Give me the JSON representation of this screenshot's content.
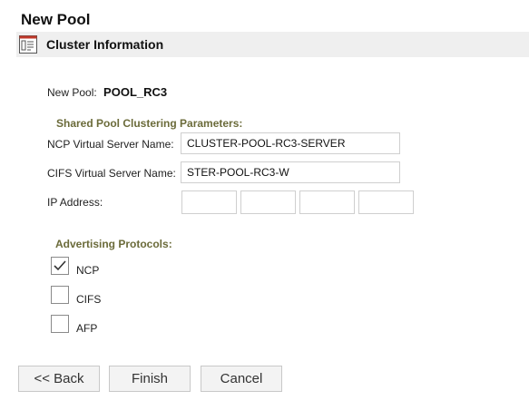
{
  "page": {
    "title": "New Pool"
  },
  "section": {
    "title": "Cluster Information",
    "icon": "form-icon"
  },
  "pool": {
    "label": "New Pool:",
    "name": "POOL_RC3"
  },
  "clustering": {
    "heading": "Shared Pool Clustering Parameters:",
    "ncp_label": "NCP Virtual Server Name:",
    "ncp_value": "CLUSTER-POOL-RC3-SERVER",
    "cifs_label": "CIFS Virtual Server Name:",
    "cifs_value": "STER-POOL-RC3-W",
    "ip_label": "IP Address:",
    "ip_octets": [
      "",
      "",
      "",
      ""
    ]
  },
  "protocols": {
    "heading": "Advertising Protocols:",
    "items": [
      {
        "label": "NCP",
        "checked": true
      },
      {
        "label": "CIFS",
        "checked": false
      },
      {
        "label": "AFP",
        "checked": false
      }
    ]
  },
  "buttons": {
    "back": "<< Back",
    "finish": "Finish",
    "cancel": "Cancel"
  }
}
